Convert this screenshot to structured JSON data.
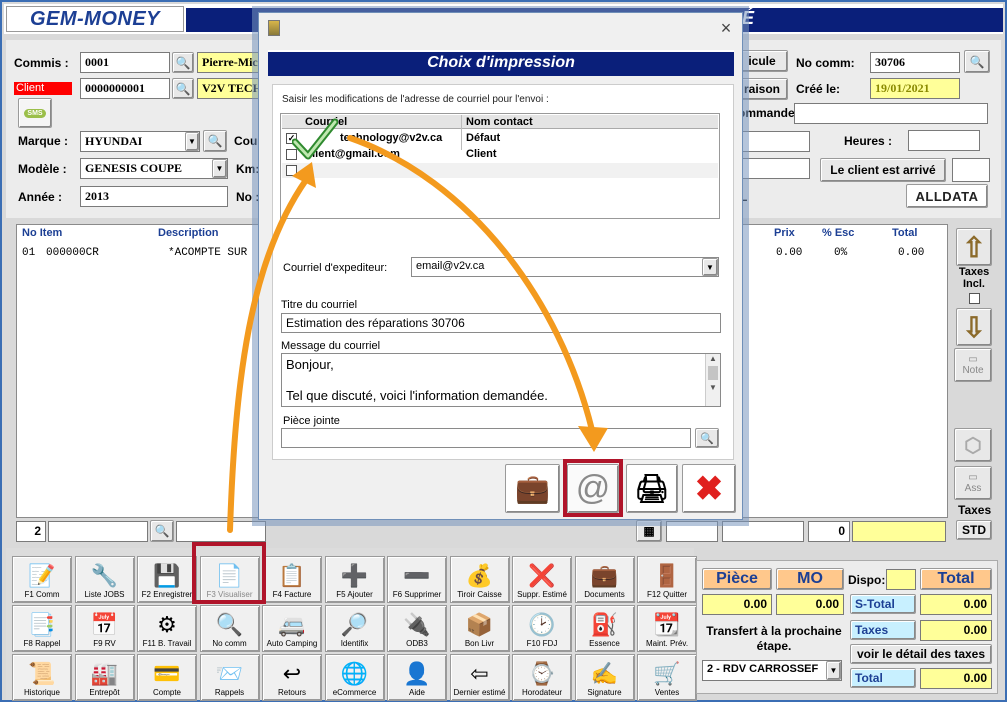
{
  "app": {
    "logo": "GEM-MONEY",
    "title_tail": "É"
  },
  "form": {
    "commis_label": "Commis :",
    "commis_code": "0001",
    "commis_name": "Pierre-Mic",
    "client_label": "Client",
    "client_code": "0000000001",
    "client_name": "V2V TECH",
    "sms_label": "SMS",
    "marque_label": "Marque :",
    "marque_value": "HYUNDAI",
    "modele_label": "Modèle :",
    "modele_value": "GENESIS COUPE",
    "annee_label": "Année :",
    "annee_value": "2013",
    "coul_label": "Coul",
    "km_label": "Km:",
    "no_label": "No :",
    "vehicule_btn": "icule",
    "livraison_btn": "raison",
    "commande_label": "ommande",
    "no_comm_label": "No comm:",
    "no_comm_value": "30706",
    "cree_label": "Créé le:",
    "cree_value": "19/01/2021",
    "heures_label": "Heures :",
    "client_arrive_btn": "Le client est arrivé",
    "alldata": "ALLDATA",
    "tail_l": "L"
  },
  "table": {
    "headers": {
      "no_item": "No Item",
      "description": "Description",
      "prix": "Prix",
      "esc": "% Esc",
      "total": "Total"
    },
    "rows": [
      {
        "no": "01",
        "item": "000000CR",
        "description": "*ACOMPTE SUR",
        "prix": "0.00",
        "esc": "0%",
        "total": "0.00"
      }
    ]
  },
  "side": {
    "taxes_incl": "Taxes Incl.",
    "note": "Note",
    "ass": "Ass",
    "taxes": "Taxes",
    "std": "STD"
  },
  "bottom_fields": {
    "qty": "2",
    "zero": "0"
  },
  "toolbar": {
    "row1": [
      "F1 Comm",
      "Liste JOBS",
      "F2 Enregistrer",
      "F3 Visualiser",
      "F4 Facture",
      "F5 Ajouter",
      "F6 Supprimer",
      "Tiroir Caisse",
      "Suppr. Estimé",
      "Documents",
      "F12 Quitter"
    ],
    "row2": [
      "F8 Rappel",
      "F9 RV",
      "F11 B. Travail",
      "No comm",
      "Auto Camping",
      "Identifix",
      "ODB3",
      "Bon Livr",
      "F10 FDJ",
      "Essence",
      "Maint. Prév."
    ],
    "row3": [
      "Historique",
      "Entrepôt",
      "Compte",
      "Rappels",
      "Retours",
      "eCommerce",
      "Aide",
      "Dernier estimé",
      "Horodateur",
      "Signature",
      "Ventes"
    ],
    "logos": {
      "auto_camping": "AUTO CAMPING",
      "identifix": "DENTIFIX",
      "odb3": "OBD3"
    }
  },
  "totals": {
    "piece_label": "Pièce",
    "mo_label": "MO",
    "dispo_label": "Dispo:",
    "total_label": "Total",
    "piece_value": "0.00",
    "mo_value": "0.00",
    "stotal_label": "S-Total",
    "stotal_value": "0.00",
    "taxes_label": "Taxes",
    "taxes_value": "0.00",
    "total_row_label": "Total",
    "total_value": "0.00",
    "transfert": "Transfert à la prochaine étape.",
    "detail_btn": "voir le détail des taxes",
    "etape_value": "2 - RDV CARROSSEF"
  },
  "dialog": {
    "title": "Choix d'impression",
    "instruction": "Saisir les modifications de l'adresse de courriel pour l'envoi :",
    "col_courriel": "Courriel",
    "col_contact": "Nom contact",
    "emails": [
      {
        "email": "technology@v2v.ca",
        "contact": "Défaut",
        "checked": true
      },
      {
        "email": "client@gmail.com",
        "contact": "Client",
        "checked": false
      },
      {
        "email": "",
        "contact": "",
        "checked": false
      }
    ],
    "sender_label": "Courriel d'expediteur:",
    "sender_value": "email@v2v.ca",
    "subject_label": "Titre du courriel",
    "subject_value": "Estimation des réparations 30706",
    "message_label": "Message du courriel",
    "message_line1": "Bonjour,",
    "message_line2": "Tel que discuté, voici l'information demandée.",
    "attachment_label": "Pièce jointe",
    "attachment_value": ""
  },
  "colors": {
    "accent_blue": "#0a1f7a",
    "highlight_red": "#b0142a",
    "arrow_orange": "#f39a1e",
    "yellow_field": "#ffff99",
    "orange_header": "#ffc88c",
    "cyan_header": "#c8f0ff"
  }
}
